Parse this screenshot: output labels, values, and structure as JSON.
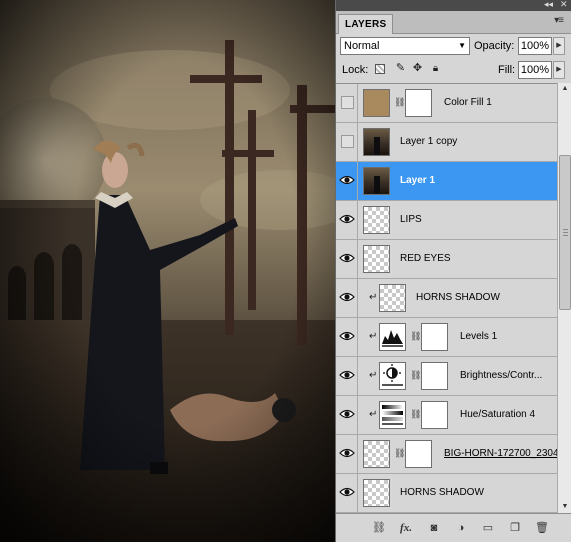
{
  "panel": {
    "tab_label": "LAYERS",
    "blend_mode": "Normal",
    "opacity_label": "Opacity:",
    "opacity_value": "100%",
    "lock_label": "Lock:",
    "fill_label": "Fill:",
    "fill_value": "100%"
  },
  "layers": [
    {
      "name": "Color Fill 1",
      "visible": false,
      "selected": false,
      "clipped": false,
      "thumb": "color",
      "mask": true
    },
    {
      "name": "Layer 1 copy",
      "visible": false,
      "selected": false,
      "clipped": false,
      "thumb": "photo",
      "mask": false
    },
    {
      "name": "Layer 1",
      "visible": true,
      "selected": true,
      "clipped": false,
      "thumb": "photo",
      "mask": false
    },
    {
      "name": "LIPS",
      "visible": true,
      "selected": false,
      "clipped": false,
      "thumb": "transparent",
      "mask": false
    },
    {
      "name": "RED EYES",
      "visible": true,
      "selected": false,
      "clipped": false,
      "thumb": "transparent",
      "mask": false
    },
    {
      "name": "HORNS SHADOW",
      "visible": true,
      "selected": false,
      "clipped": true,
      "thumb": "transparent",
      "mask": false
    },
    {
      "name": "Levels 1",
      "visible": true,
      "selected": false,
      "clipped": true,
      "thumb": "levels",
      "mask": true
    },
    {
      "name": "Brightness/Contr...",
      "visible": true,
      "selected": false,
      "clipped": true,
      "thumb": "brightness",
      "mask": true
    },
    {
      "name": "Hue/Saturation 4",
      "visible": true,
      "selected": false,
      "clipped": true,
      "thumb": "hue",
      "mask": true
    },
    {
      "name": "BIG-HORN-172700_2304",
      "visible": true,
      "selected": false,
      "clipped": false,
      "thumb": "transparent",
      "mask": true,
      "underline": true
    },
    {
      "name": "HORNS SHADOW",
      "visible": true,
      "selected": false,
      "clipped": false,
      "thumb": "transparent",
      "mask": false
    }
  ],
  "colors": {
    "selected": "#3c97f3",
    "color_fill": "#a88a5e",
    "panel_bg": "#d6d6d6"
  },
  "icons": {
    "footer": [
      "link-layers-icon",
      "fx-icon",
      "add-mask-icon",
      "adjustment-layer-icon",
      "new-group-icon",
      "new-layer-icon",
      "trash-icon"
    ],
    "lock": [
      "lock-transparent-icon",
      "lock-image-icon",
      "lock-position-icon",
      "lock-all-icon"
    ]
  }
}
